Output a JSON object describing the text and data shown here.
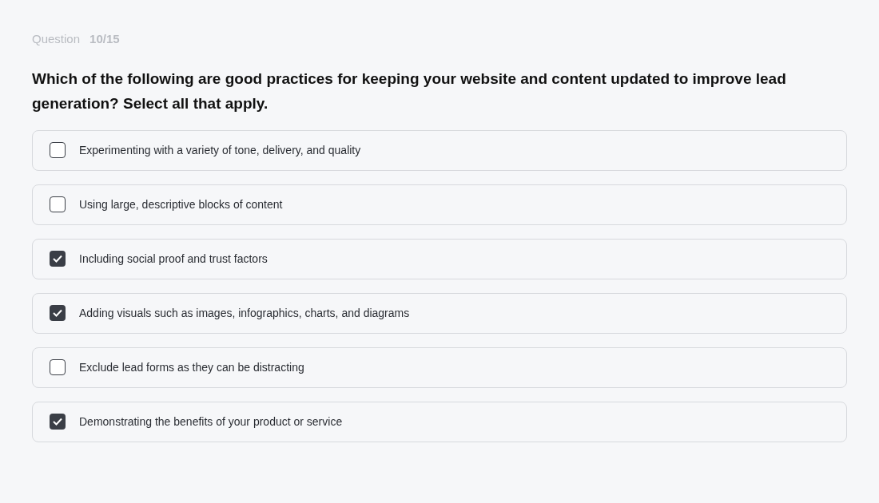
{
  "progress": {
    "label": "Question",
    "count": "10/15"
  },
  "question": "Which of the following are good practices for keeping your website and content updated to improve lead generation? Select all that apply.",
  "options": [
    {
      "label": "Experimenting with a variety of tone, delivery, and quality",
      "checked": false
    },
    {
      "label": "Using large, descriptive blocks of content",
      "checked": false
    },
    {
      "label": "Including social proof and trust factors",
      "checked": true
    },
    {
      "label": "Adding visuals such as images, infographics, charts, and diagrams",
      "checked": true
    },
    {
      "label": "Exclude lead forms as they can be distracting",
      "checked": false
    },
    {
      "label": "Demonstrating the benefits of your product or service",
      "checked": true
    }
  ]
}
